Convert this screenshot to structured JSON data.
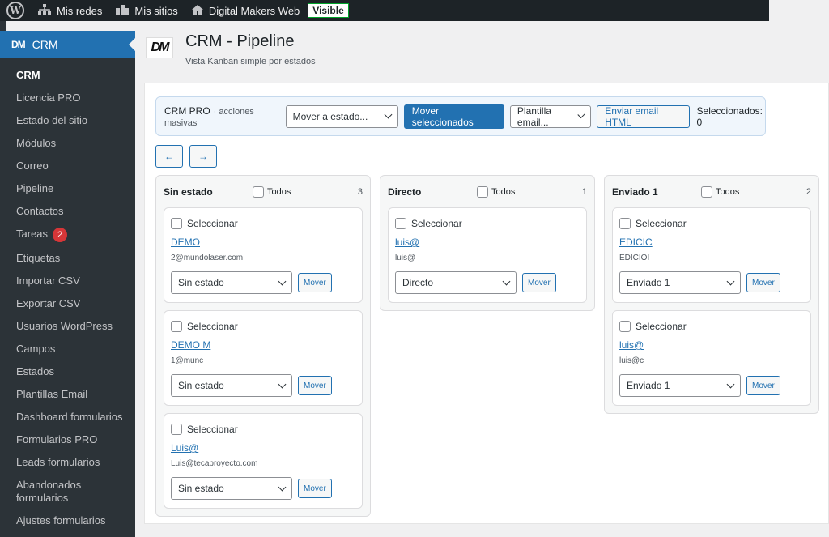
{
  "admin_bar": {
    "my_networks": "Mis redes",
    "my_sites": "Mis sitios",
    "site_name": "Digital Makers Web",
    "visibility_badge": "Visible"
  },
  "sidebar": {
    "menu_title": "CRM",
    "menu_logo_text": "DM",
    "items": [
      {
        "label": "CRM",
        "current": true
      },
      {
        "label": "Licencia PRO"
      },
      {
        "label": "Estado del sitio"
      },
      {
        "label": "Módulos"
      },
      {
        "label": "Correo"
      },
      {
        "label": "Pipeline"
      },
      {
        "label": "Contactos"
      },
      {
        "label": "Tareas",
        "count": "2"
      },
      {
        "label": "Etiquetas"
      },
      {
        "label": "Importar CSV"
      },
      {
        "label": "Exportar CSV"
      },
      {
        "label": "Usuarios WordPress"
      },
      {
        "label": "Campos"
      },
      {
        "label": "Estados"
      },
      {
        "label": "Plantillas Email"
      },
      {
        "label": "Dashboard formularios"
      },
      {
        "label": "Formularios PRO"
      },
      {
        "label": "Leads formularios"
      },
      {
        "label": "Abandonados formularios"
      },
      {
        "label": "Ajustes formularios"
      }
    ]
  },
  "page": {
    "logo_text": "DM",
    "title": "CRM - Pipeline",
    "subtitle": "Vista Kanban simple por estados"
  },
  "toolbar": {
    "label": "CRM PRO",
    "label_small": "· acciones masivas",
    "move_select": "Mover a estado...",
    "move_selected_button": "Mover seleccionados",
    "template_select": "Plantilla email...",
    "send_email_button": "Enviar email HTML",
    "selected_count": "Seleccionados: 0"
  },
  "nav": {
    "prev": "←",
    "next": "→"
  },
  "columns": [
    {
      "name": "Sin estado",
      "all_label": "Todos",
      "count": "3",
      "cards": [
        {
          "select_label": "Seleccionar",
          "lead": "DEMO",
          "email": "2@mundolaser.com",
          "status": "Sin estado",
          "move": "Mover"
        },
        {
          "select_label": "Seleccionar",
          "lead": "DEMO M",
          "email": "1@munc",
          "status": "Sin estado",
          "move": "Mover"
        },
        {
          "select_label": "Seleccionar",
          "lead": "Luis@",
          "email": "Luis@tecaproyecto.com",
          "status": "Sin estado",
          "move": "Mover"
        }
      ]
    },
    {
      "name": "Directo",
      "all_label": "Todos",
      "count": "1",
      "cards": [
        {
          "select_label": "Seleccionar",
          "lead": "luis@",
          "email": "luis@",
          "status": "Directo",
          "move": "Mover"
        }
      ]
    },
    {
      "name": "Enviado 1",
      "all_label": "Todos",
      "count": "2",
      "cards": [
        {
          "select_label": "Seleccionar",
          "lead": "EDICIC",
          "email": "EDICIOI",
          "status": "Enviado 1",
          "move": "Mover"
        },
        {
          "select_label": "Seleccionar",
          "lead": "luis@",
          "email": "luis@c",
          "status": "Enviado 1",
          "move": "Mover"
        }
      ]
    }
  ]
}
